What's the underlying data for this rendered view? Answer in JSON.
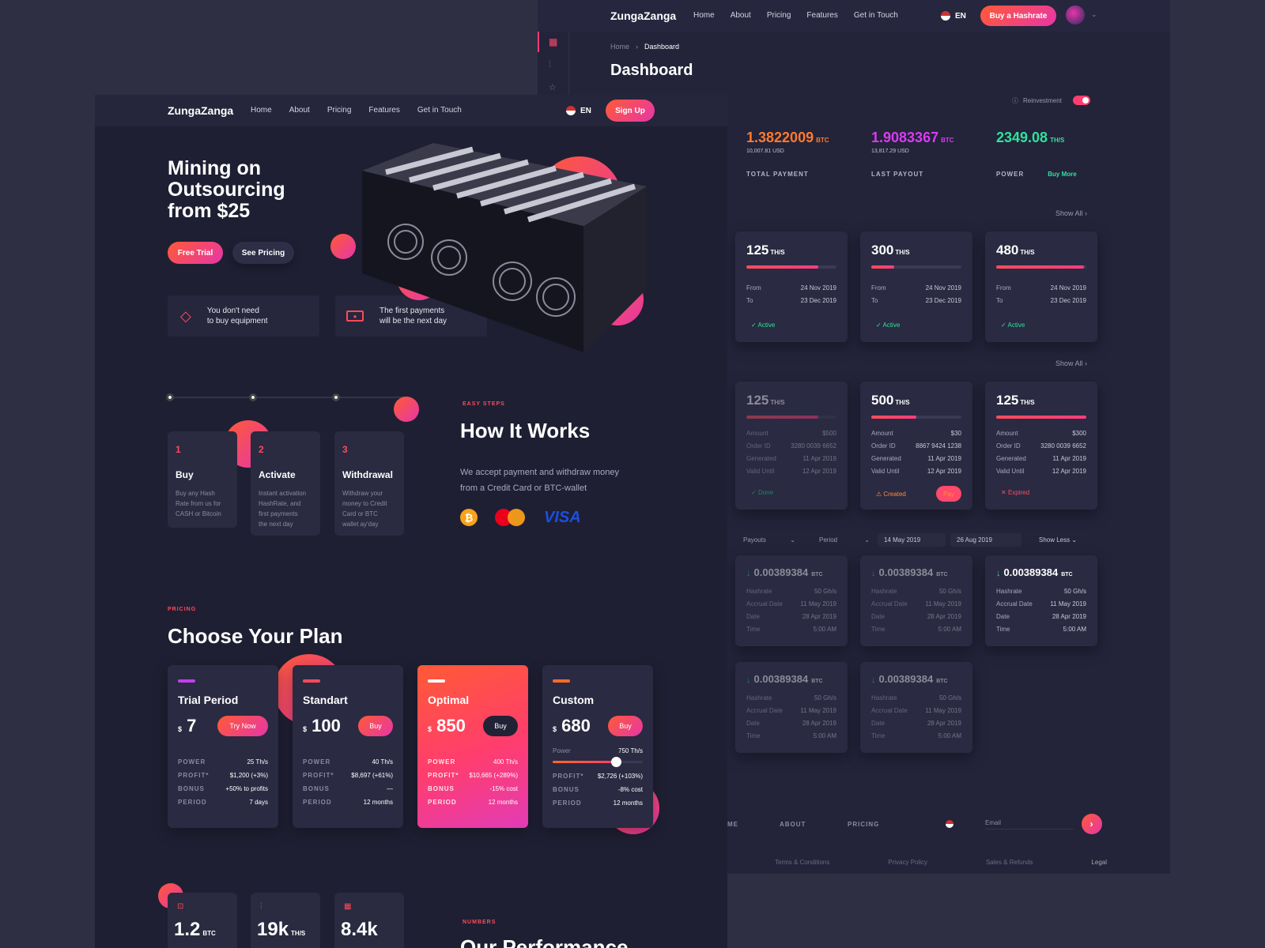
{
  "dash": {
    "brand": "ZungaZanga",
    "nav": [
      "Home",
      "About",
      "Pricing",
      "Features",
      "Get in Touch"
    ],
    "lang": "EN",
    "cta": "Buy a Hashrate",
    "breadcrumb_home": "Home",
    "breadcrumb_current": "Dashboard",
    "title": "Dashboard",
    "reinvest_label": "Reinvestment",
    "stats": [
      {
        "value": "1.3822009",
        "unit": "BTC",
        "sub": "10,007.81 USD",
        "label": "TOTAL PAYMENT",
        "color": "#ff7a2e"
      },
      {
        "value": "1.9083367",
        "unit": "BTC",
        "sub": "13,817.29 USD",
        "label": "LAST PAYOUT",
        "color": "#d83cf0"
      },
      {
        "value": "2349.08",
        "unit": "TH/S",
        "sub": "",
        "label": "POWER",
        "color": "#2fe29a",
        "extra": "Buy More"
      }
    ],
    "show_all": "Show All",
    "contracts": [
      {
        "hash": "125",
        "unit": "TH/S",
        "progress": 0.8,
        "from_label": "From",
        "from": "24 Nov 2019",
        "to_label": "To",
        "to": "23 Dec 2019",
        "status": "Active"
      },
      {
        "hash": "300",
        "unit": "TH/S",
        "progress": 0.25,
        "from_label": "From",
        "from": "24 Nov 2019",
        "to_label": "To",
        "to": "23 Dec 2019",
        "status": "Active"
      },
      {
        "hash": "480",
        "unit": "TH/S",
        "progress": 0.97,
        "from_label": "From",
        "from": "24 Nov 2019",
        "to_label": "To",
        "to": "23 Dec 2019",
        "status": "Active"
      }
    ],
    "orders": [
      {
        "hash": "125",
        "unit": "TH/S",
        "progress": 0.8,
        "rows": [
          [
            "Amount",
            "$500"
          ],
          [
            "Order ID",
            "3280 0039 6652"
          ],
          [
            "Generated",
            "11 Apr 2019"
          ],
          [
            "Valid Until",
            "12 Apr 2019"
          ]
        ],
        "status": "Done",
        "dim": true
      },
      {
        "hash": "500",
        "unit": "TH/S",
        "progress": 0.5,
        "rows": [
          [
            "Amount",
            "$30"
          ],
          [
            "Order ID",
            "8867 9424 1238"
          ],
          [
            "Generated",
            "11 Apr 2019"
          ],
          [
            "Valid Until",
            "12 Apr 2019"
          ]
        ],
        "status": "Created",
        "pay": "Pay",
        "dim": false
      },
      {
        "hash": "125",
        "unit": "TH/S",
        "progress": 1.0,
        "rows": [
          [
            "Amount",
            "$300"
          ],
          [
            "Order ID",
            "3280 0039 6652"
          ],
          [
            "Generated",
            "11 Apr 2019"
          ],
          [
            "Valid Until",
            "12 Apr 2019"
          ]
        ],
        "status": "Expired",
        "dim": false
      }
    ],
    "filters": {
      "payouts": "Payouts",
      "period": "Period",
      "date_from": "14 May 2019",
      "date_to": "26 Aug 2019",
      "toggle": "Show Less"
    },
    "payouts": [
      {
        "amount": "0.00389384",
        "unit": "BTC",
        "dim": true
      },
      {
        "amount": "0.00389384",
        "unit": "BTC",
        "dim": true
      },
      {
        "amount": "0.00389384",
        "unit": "BTC",
        "dim": false
      },
      {
        "amount": "0.00389384",
        "unit": "BTC",
        "dim": true
      },
      {
        "amount": "0.00389384",
        "unit": "BTC",
        "dim": true
      }
    ],
    "payout_rows": [
      [
        "Hashrate",
        "50 Gh/s"
      ],
      [
        "Accrual Date",
        "11 May 2019"
      ],
      [
        "Date",
        "28 Apr 2019"
      ],
      [
        "Time",
        "5:00 AM"
      ]
    ],
    "footer_nav": [
      "ME",
      "ABOUT",
      "PRICING"
    ],
    "email_placeholder": "Email",
    "footer_links": [
      "Terms & Conditions",
      "Privacy Policy",
      "Sales & Refunds",
      "Legal"
    ]
  },
  "land": {
    "brand": "ZungaZanga",
    "nav": [
      "Home",
      "About",
      "Pricing",
      "Features",
      "Get in Touch"
    ],
    "lang": "EN",
    "signup": "Sign Up",
    "hero_line1": "Mining on",
    "hero_line2": "Outsourcing",
    "hero_line3": "from $25",
    "btn_trial": "Free Trial",
    "btn_pricing": "See Pricing",
    "feature1_a": "You don't need",
    "feature1_b": "to buy equipment",
    "feature2_a": "The first payments",
    "feature2_b": "will be the next day",
    "steps": [
      {
        "num": "1",
        "title": "Buy",
        "desc": [
          "Buy any Hash",
          "Rate from us for",
          "CASH or Bitcoin"
        ]
      },
      {
        "num": "2",
        "title": "Activate",
        "desc": [
          "Instant activation",
          "HashRate, and",
          "first payments",
          "the next day"
        ]
      },
      {
        "num": "3",
        "title": "Withdrawal",
        "desc": [
          "Withdraw your",
          "money to Credit",
          "Card or BTC",
          "wallet ay'day"
        ]
      }
    ],
    "easy_steps": "EASY STEPS",
    "how_title": "How It Works",
    "how_desc1": "We accept payment and withdraw money",
    "how_desc2": "from a Credit Card or BTC-wallet",
    "visa": "VISA",
    "pricing_eyebrow": "PRICING",
    "pricing_title": "Choose Your Plan",
    "plans": [
      {
        "name": "Trial Period",
        "price": "7",
        "btn": "Try Now",
        "accent": "#c23ff0",
        "rows": [
          [
            "POWER",
            "25 Th/s"
          ],
          [
            "PROFIT*",
            "$1,200 (+3%)"
          ],
          [
            "BONUS",
            "+50% to profits"
          ],
          [
            "PERIOD",
            "7 days"
          ]
        ]
      },
      {
        "name": "Standart",
        "price": "100",
        "btn": "Buy",
        "accent": "#ff4a5a",
        "rows": [
          [
            "POWER",
            "40 Th/s"
          ],
          [
            "PROFIT*",
            "$8,697 (+61%)"
          ],
          [
            "BONUS",
            "—"
          ],
          [
            "PERIOD",
            "12 months"
          ]
        ]
      },
      {
        "name": "Optimal",
        "price": "850",
        "btn": "Buy",
        "accent": "#ffffff",
        "rows": [
          [
            "POWER",
            "400 Th/s"
          ],
          [
            "PROFIT*",
            "$10,665 (+289%)"
          ],
          [
            "BONUS",
            "-15% cost"
          ],
          [
            "PERIOD",
            "12 months"
          ]
        ]
      },
      {
        "name": "Custom",
        "price": "680",
        "btn": "Buy",
        "accent": "#ff6a2a",
        "power_label": "Power",
        "power_value": "750 Th/s",
        "slider": 0.7,
        "rows": [
          [
            "PROFIT*",
            "$2,726 (+103%)"
          ],
          [
            "BONUS",
            "-8% cost"
          ],
          [
            "PERIOD",
            "12 months"
          ]
        ]
      }
    ],
    "currency": "$",
    "numbers_eyebrow": "NUMBERS",
    "perf_title": "Our Performance",
    "numbers": [
      {
        "value": "1.2",
        "unit": "BTC"
      },
      {
        "value": "19k",
        "unit": "TH/S"
      },
      {
        "value": "8.4k",
        "unit": ""
      }
    ]
  }
}
